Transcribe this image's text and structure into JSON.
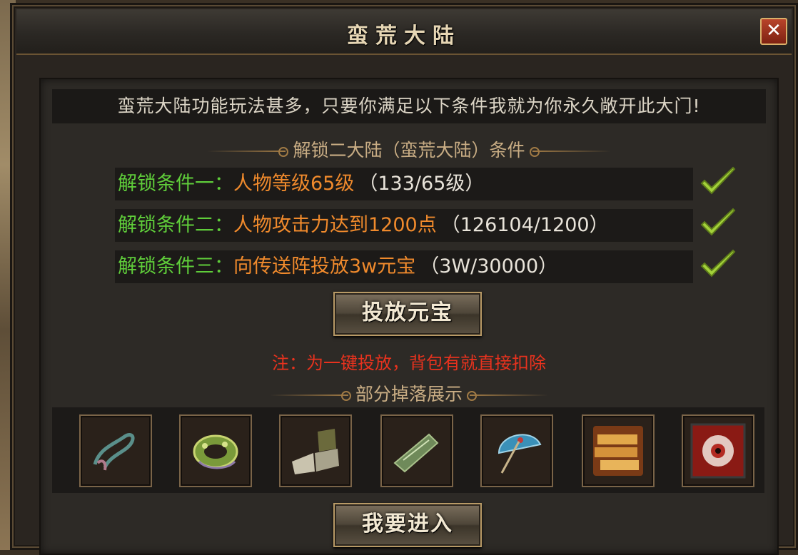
{
  "window": {
    "title": "蛮荒大陆",
    "close_label": "✕"
  },
  "intro_text": "蛮荒大陆功能玩法甚多，只要你满足以下条件我就为你永久敞开此大门!",
  "unlock_section": {
    "heading": "解锁二大陆（蛮荒大陆）条件",
    "conditions": [
      {
        "label": "解锁条件一：",
        "requirement": "人物等级65级",
        "progress": "（133/65级）",
        "met": true
      },
      {
        "label": "解锁条件二：",
        "requirement": "人物攻击力达到1200点",
        "progress": "（126104/1200）",
        "met": true
      },
      {
        "label": "解锁条件三：",
        "requirement": "向传送阵投放3w元宝",
        "progress": "（3W/30000）",
        "met": true
      }
    ]
  },
  "deposit_button_label": "投放元宝",
  "note_text": "注：为一键投放，背包有就直接扣除",
  "drops_section": {
    "heading": "部分掉落展示",
    "items": [
      {
        "icon": "ribbon-sash-icon"
      },
      {
        "icon": "jade-bracelet-icon"
      },
      {
        "icon": "open-book-icon"
      },
      {
        "icon": "jade-scroll-icon"
      },
      {
        "icon": "blue-umbrella-icon"
      },
      {
        "icon": "gold-ingots-icon"
      },
      {
        "icon": "red-eye-icon"
      }
    ]
  },
  "enter_button_label": "我要进入",
  "colors": {
    "condition_label": "#5fcd3a",
    "requirement": "#f08a2c",
    "note": "#e8321e",
    "check": "#9acd32"
  }
}
